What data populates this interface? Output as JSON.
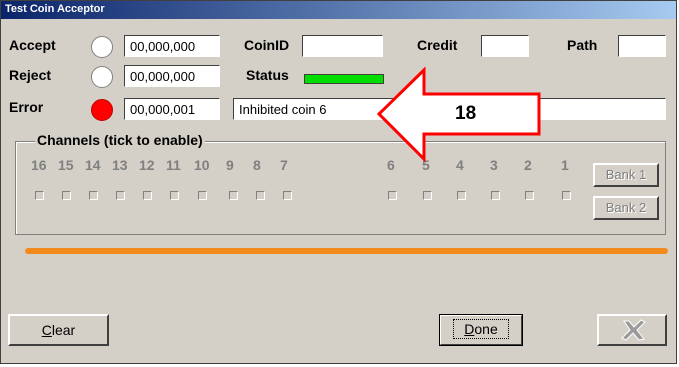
{
  "window": {
    "title": "Test Coin Acceptor"
  },
  "accept": {
    "label": "Accept",
    "value": "00,000,000"
  },
  "reject": {
    "label": "Reject",
    "value": "00,000,000"
  },
  "error": {
    "label": "Error",
    "value": "00,000,001",
    "message": "Inhibited coin 6"
  },
  "coin": {
    "label": "CoinID",
    "value": ""
  },
  "credit": {
    "label": "Credit",
    "value": ""
  },
  "path": {
    "label": "Path",
    "value": ""
  },
  "status": {
    "label": "Status",
    "color": "#00dd00"
  },
  "channels": {
    "title": "Channels (tick to enable)",
    "numbers": [
      "16",
      "15",
      "14",
      "13",
      "12",
      "11",
      "10",
      "9",
      "8",
      "7",
      "6",
      "5",
      "4",
      "3",
      "2",
      "1"
    ]
  },
  "bank": {
    "bank1": "Bank 1",
    "bank2": "Bank 2"
  },
  "buttons": {
    "clear_prefix": "C",
    "clear_rest": "lear",
    "done_prefix": "D",
    "done_rest": "one"
  },
  "annotation": {
    "number": "18",
    "color": "#ff0000"
  },
  "colors": {
    "title_bar": "#0a246a",
    "error_indicator": "#ff0000",
    "separator": "#f28b1c"
  }
}
